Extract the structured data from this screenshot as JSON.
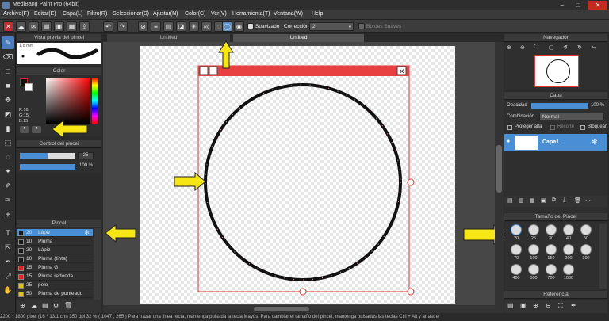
{
  "window": {
    "title": "MediBang Paint Pro (64bit)"
  },
  "menu": [
    "Archivo(F)",
    "Editar(E)",
    "Capa(L)",
    "Filtro(R)",
    "Seleccionar(S)",
    "Ajustar(N)",
    "Color(C)",
    "Ver(V)",
    "Herramienta(T)",
    "Ventana(W)",
    "Help"
  ],
  "toolbar": {
    "smooth_label": "Suavizado",
    "correction_label": "Corrección",
    "correction_value": "2",
    "soft_edges_label": "Bordes Suaves"
  },
  "tabs": [
    "Untitled",
    "Untitled"
  ],
  "brush_preview": {
    "title": "Vista previa del pincel",
    "size": "1.8 mm"
  },
  "color": {
    "title": "Color",
    "r": "R:16",
    "g": "G:15",
    "b": "B:15"
  },
  "brush_control": {
    "title": "Control del pincel",
    "size_value": "25",
    "opacity_value": "100 %"
  },
  "brush_panel": {
    "title": "Pincel",
    "items": [
      {
        "num": "20",
        "name": "Lápiz",
        "color": "#1a1a1a"
      },
      {
        "num": "10",
        "name": "Pluma",
        "color": "#1a1a1a"
      },
      {
        "num": "20",
        "name": "Lápiz",
        "color": "#1a1a1a"
      },
      {
        "num": "10",
        "name": "Pluma (tinta)",
        "color": "#1a1a1a"
      },
      {
        "num": "15",
        "name": "Pluma G",
        "color": "#e02020"
      },
      {
        "num": "15",
        "name": "Pluma redonda",
        "color": "#e02020"
      },
      {
        "num": "25",
        "name": "pelo",
        "color": "#e0c020"
      },
      {
        "num": "50",
        "name": "Pluma de punteado",
        "color": "#e0c020"
      }
    ]
  },
  "navigator": {
    "title": "Navegador"
  },
  "layer": {
    "title": "Capa",
    "opacity_label": "Opacidad",
    "opacity_value": "100 %",
    "blend_label": "Combinación",
    "blend_value": "Normal",
    "protect_alpha": "Proteger alfa",
    "clip": "Recorte",
    "lock": "Bloquear",
    "layer_name": "Capa1"
  },
  "brush_size": {
    "title": "Tamaño del Pincel",
    "sizes": [
      "20",
      "25",
      "30",
      "40",
      "50",
      "70",
      "100",
      "150",
      "200",
      "300",
      "400",
      "500",
      "700",
      "1000"
    ]
  },
  "reference": {
    "title": "Referencia"
  },
  "status": "2200 * 1800 pixel   (16 * 13.1 cm)   350 dpi   32 %   ( 1047 , 265 )   Para trazar una línea recta, mantenga pulsada la tecla Mayús. Para cambiar el tamaño del pincel, mantenga pulsadas las teclas Ctrl + Alt y arrastre",
  "colors": {
    "accent": "#4a8fd6",
    "arrow": "#f5e614",
    "selection_red": "#e33333"
  }
}
